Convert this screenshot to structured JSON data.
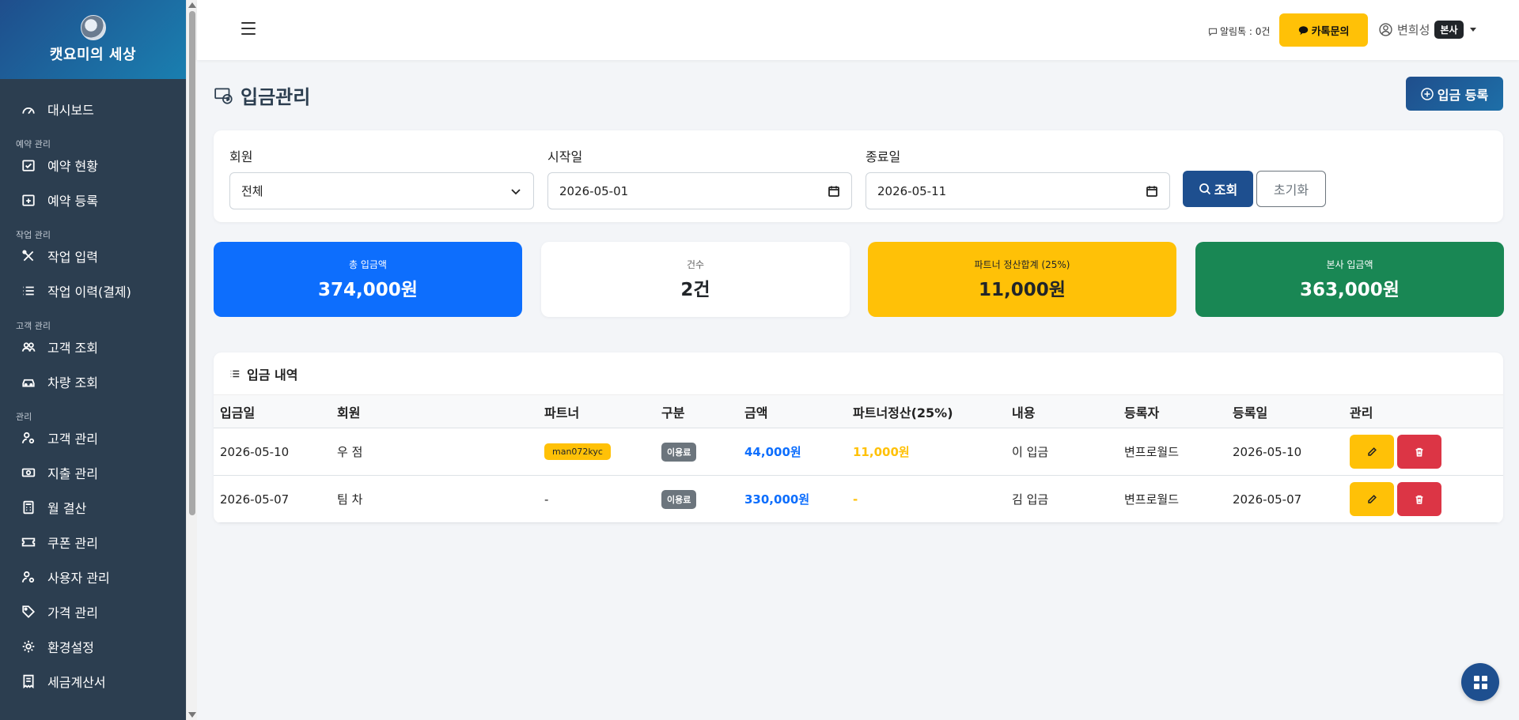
{
  "sidebar": {
    "brand": "캣요미의 세상",
    "nav": [
      {
        "type": "item",
        "label": "대시보드",
        "icon": "dashboard-icon"
      },
      {
        "type": "section",
        "label": "예약 관리"
      },
      {
        "type": "item",
        "label": "예약 현황",
        "icon": "calendar-check-icon"
      },
      {
        "type": "item",
        "label": "예약 등록",
        "icon": "calendar-plus-icon"
      },
      {
        "type": "section",
        "label": "작업 관리"
      },
      {
        "type": "item",
        "label": "작업 입력",
        "icon": "tools-icon"
      },
      {
        "type": "item",
        "label": "작업 이력(결제)",
        "icon": "list-icon"
      },
      {
        "type": "section",
        "label": "고객 관리"
      },
      {
        "type": "item",
        "label": "고객 조회",
        "icon": "people-icon"
      },
      {
        "type": "item",
        "label": "차량 조회",
        "icon": "car-icon"
      },
      {
        "type": "section",
        "label": "관리"
      },
      {
        "type": "item",
        "label": "고객 관리",
        "icon": "person-gear-icon"
      },
      {
        "type": "item",
        "label": "지출 관리",
        "icon": "cash-icon"
      },
      {
        "type": "item",
        "label": "월 결산",
        "icon": "calculator-icon"
      },
      {
        "type": "item",
        "label": "쿠폰 관리",
        "icon": "ticket-icon"
      },
      {
        "type": "item",
        "label": "사용자 관리",
        "icon": "person-gear-icon"
      },
      {
        "type": "item",
        "label": "가격 관리",
        "icon": "tag-icon"
      },
      {
        "type": "item",
        "label": "환경설정",
        "icon": "gear-icon"
      },
      {
        "type": "item",
        "label": "세금계산서",
        "icon": "receipt-icon"
      }
    ]
  },
  "topbar": {
    "alimtalk": "알림톡 : 0건",
    "kakao_button": "카톡문의",
    "user_name": "변희성",
    "user_badge": "본사"
  },
  "page": {
    "title": "입금관리",
    "register_button": "입금 등록"
  },
  "filters": {
    "member_label": "회원",
    "member_value": "전체",
    "start_label": "시작일",
    "start_value": "2026-05-01",
    "end_label": "종료일",
    "end_value": "2026-05-11",
    "search_button": "조회",
    "reset_button": "초기화"
  },
  "stats": {
    "total_label": "총 입금액",
    "total_value": "374,000원",
    "count_label": "건수",
    "count_value": "2건",
    "partner_label": "파트너 정산합계 (25%)",
    "partner_value": "11,000원",
    "hq_label": "본사 입금액",
    "hq_value": "363,000원"
  },
  "table": {
    "title": "입금 내역",
    "headers": [
      "입금일",
      "회원",
      "파트너",
      "구분",
      "금액",
      "파트너정산(25%)",
      "내용",
      "등록자",
      "등록일",
      "관리"
    ],
    "rows": [
      {
        "date": "2026-05-10",
        "member": "우 점",
        "partner": "man072kyc",
        "type": "이용료",
        "amount": "44,000원",
        "settle": "11,000원",
        "content": "이 입금",
        "registrar": "변프로월드",
        "reg_date": "2026-05-10"
      },
      {
        "date": "2026-05-07",
        "member": "팀 차",
        "partner": "-",
        "type": "이용료",
        "amount": "330,000원",
        "settle": "-",
        "content": "김 입금",
        "registrar": "변프로월드",
        "reg_date": "2026-05-07"
      }
    ]
  },
  "colors": {
    "sidebar_bg": "#2c3e50",
    "primary": "#0d6efd",
    "warning": "#ffc107",
    "success": "#198754",
    "danger": "#dc3545",
    "navy": "#1e4f8f"
  }
}
